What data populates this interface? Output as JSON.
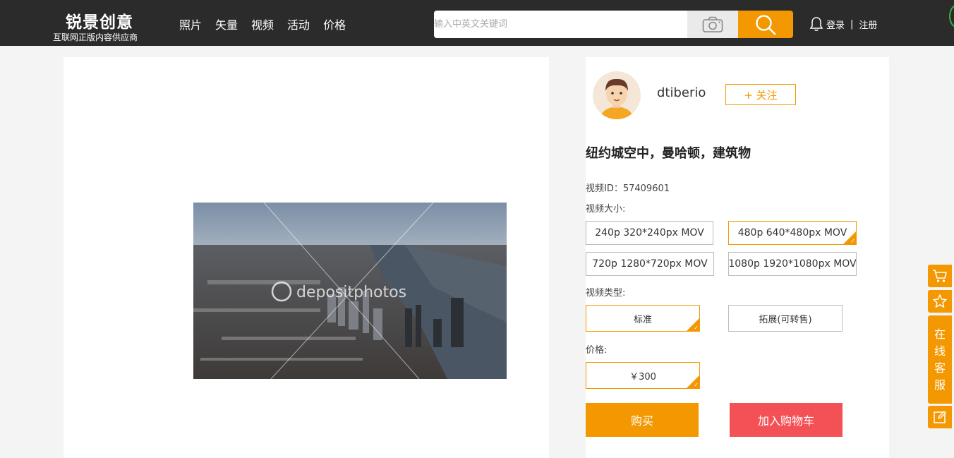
{
  "header": {
    "logo_title": "锐景创意",
    "logo_subtitle": "互联网正版内容供应商",
    "nav": [
      {
        "label": "照片"
      },
      {
        "label": "矢量"
      },
      {
        "label": "视频"
      },
      {
        "label": "活动"
      },
      {
        "label": "价格"
      }
    ],
    "search_placeholder": "输入中英文关键词",
    "login": "登录",
    "separator": "|",
    "register": "注册"
  },
  "author": {
    "name": "dtiberio",
    "follow_label": "+ 关注"
  },
  "video": {
    "title": "纽约城空中，曼哈顿，建筑物",
    "id_text": "视频ID：57409601",
    "watermark": "depositphotos"
  },
  "options": {
    "size_label": "视频大小:",
    "sizes": [
      {
        "label": "240p 320*240px MOV",
        "selected": false
      },
      {
        "label": "480p 640*480px MOV",
        "selected": true
      },
      {
        "label": "720p 1280*720px MOV",
        "selected": false
      },
      {
        "label": "1080p 1920*1080px MOV",
        "selected": false
      }
    ],
    "type_label": "视频类型:",
    "types": [
      {
        "label": "标准",
        "selected": true
      },
      {
        "label": "拓展(可转售)",
        "selected": false
      }
    ],
    "price_label": "价格:",
    "price": "￥300"
  },
  "actions": {
    "buy": "购买",
    "add_to_cart": "加入购物车"
  },
  "sidebar": {
    "service_chars": [
      "在",
      "线",
      "客",
      "服"
    ]
  },
  "colors": {
    "accent": "#f39800",
    "cart_red": "#f45156",
    "topbar": "#2b2b2b"
  }
}
